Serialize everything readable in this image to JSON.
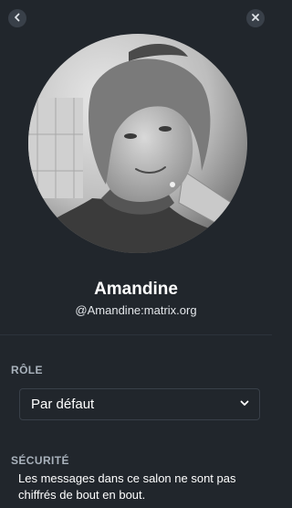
{
  "header": {
    "back_icon": "chevron-left-icon",
    "close_icon": "close-icon"
  },
  "profile": {
    "name": "Amandine",
    "handle": "@Amandine:matrix.org"
  },
  "role": {
    "title": "RÔLE",
    "selected": "Par défaut",
    "dropdown_icon": "chevron-down-icon"
  },
  "security": {
    "title": "SÉCURITÉ",
    "text": "Les messages dans ce salon ne sont pas chiffrés de bout en bout."
  },
  "colors": {
    "background": "#21262c",
    "button_bg": "#394049",
    "muted_text": "#a9b2bc"
  }
}
